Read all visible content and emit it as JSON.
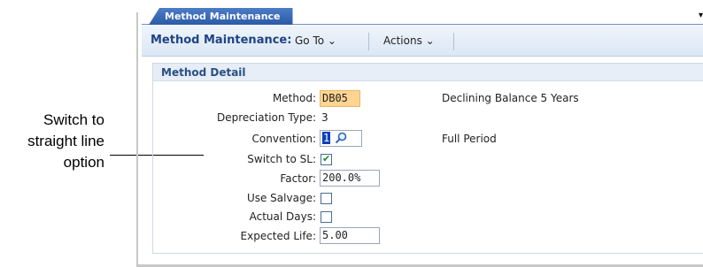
{
  "callout": {
    "line1": "Switch to",
    "line2": "straight line",
    "line3": "option"
  },
  "tab": {
    "label": "Method Maintenance",
    "menu_arrow": "▾"
  },
  "toolbar": {
    "title": "Method Maintenance:",
    "goto_label": "Go To ⌄",
    "actions_label": "Actions ⌄"
  },
  "panel": {
    "header": "Method Detail",
    "method": {
      "label": "Method:",
      "value": "DB05",
      "description": "Declining Balance 5 Years"
    },
    "depreciation_type": {
      "label": "Depreciation Type:",
      "value": "3"
    },
    "convention": {
      "label": "Convention:",
      "value": "1",
      "description": "Full Period"
    },
    "switch_to_sl": {
      "label": "Switch to SL:",
      "checked": true
    },
    "factor": {
      "label": "Factor:",
      "value": "200.0%"
    },
    "use_salvage": {
      "label": "Use Salvage:",
      "checked": false
    },
    "actual_days": {
      "label": "Actual Days:",
      "checked": false
    },
    "expected_life": {
      "label": "Expected Life:",
      "value": "5.00"
    }
  },
  "colors": {
    "accent": "#2b5aa6",
    "highlight": "#ffd591",
    "header_text": "#1e4483"
  }
}
